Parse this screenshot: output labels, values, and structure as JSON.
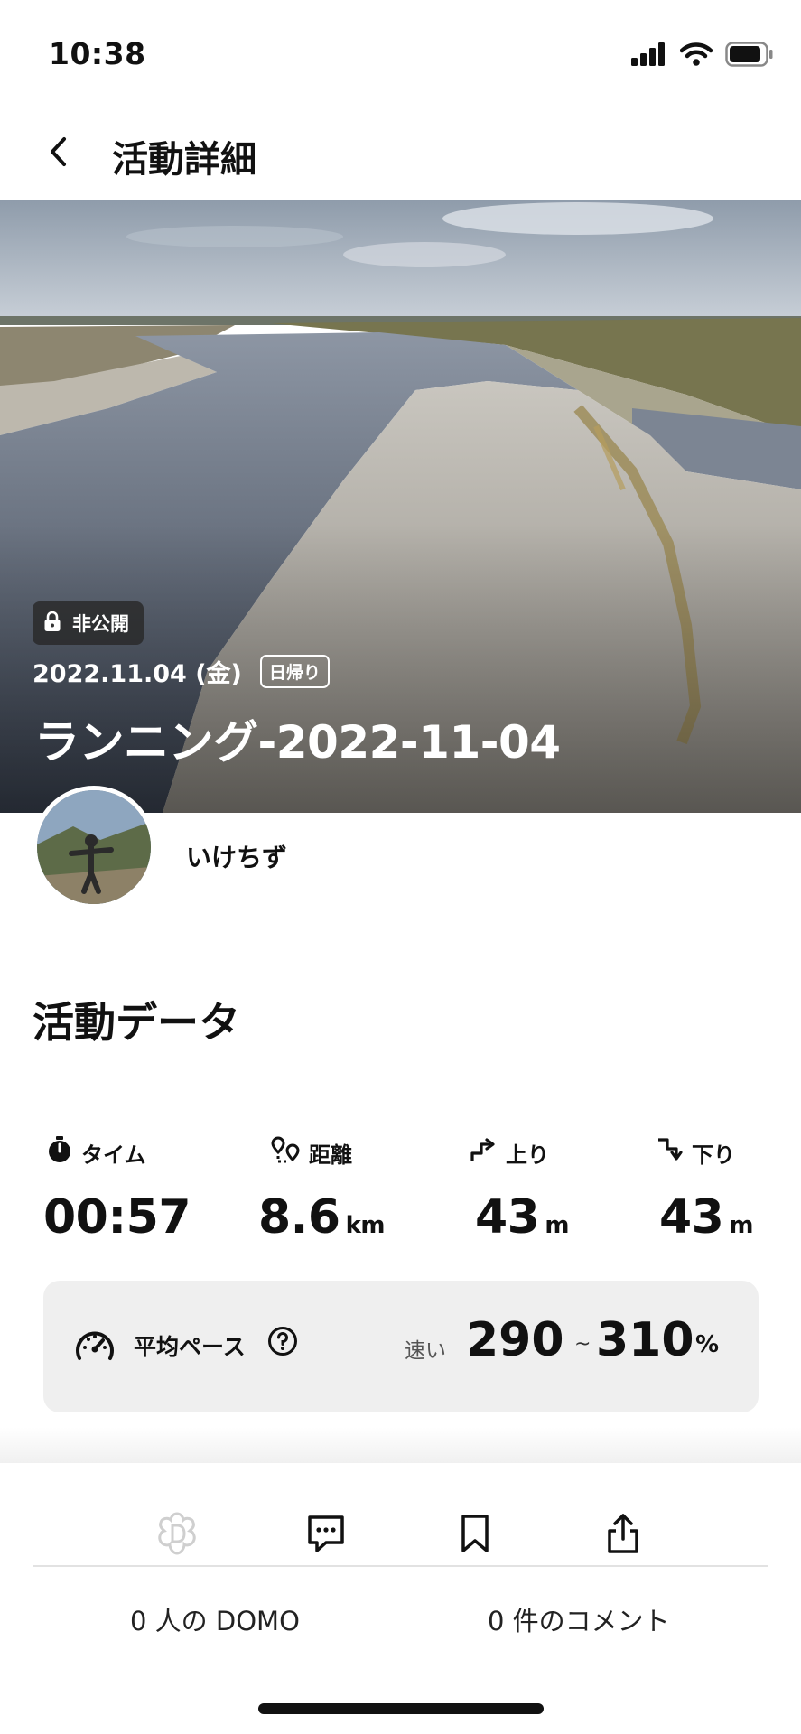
{
  "status_bar": {
    "time": "10:38"
  },
  "nav": {
    "title": "活動詳細",
    "back_icon": "chevron-left-icon"
  },
  "hero": {
    "privacy_label": "非公開",
    "date": "2022.11.04 (金)",
    "trip_tag": "日帰り",
    "title": "ランニング-2022-11-04"
  },
  "user": {
    "name": "いけちず"
  },
  "activity_data": {
    "section_title": "活動データ",
    "stats": [
      {
        "label": "タイム",
        "value": "00:57",
        "unit": "",
        "icon": "stopwatch-icon"
      },
      {
        "label": "距離",
        "value": "8.6",
        "unit": "km",
        "icon": "route-pin-icon"
      },
      {
        "label": "上り",
        "value": "43",
        "unit": "m",
        "icon": "ascent-icon"
      },
      {
        "label": "下り",
        "value": "43",
        "unit": "m",
        "icon": "descent-icon"
      }
    ],
    "pace": {
      "label": "平均ペース",
      "speed_label": "速い",
      "min": "290",
      "separator": "~",
      "max": "310",
      "unit": "%"
    }
  },
  "actions": {
    "buttons": [
      "domo-icon",
      "comment-icon",
      "bookmark-icon",
      "share-icon"
    ],
    "domo_count": "0 人の DOMO",
    "comment_count": "0 件のコメント"
  },
  "colors": {
    "accent": "#111111",
    "background": "#ffffff",
    "panel": "#efefef"
  }
}
